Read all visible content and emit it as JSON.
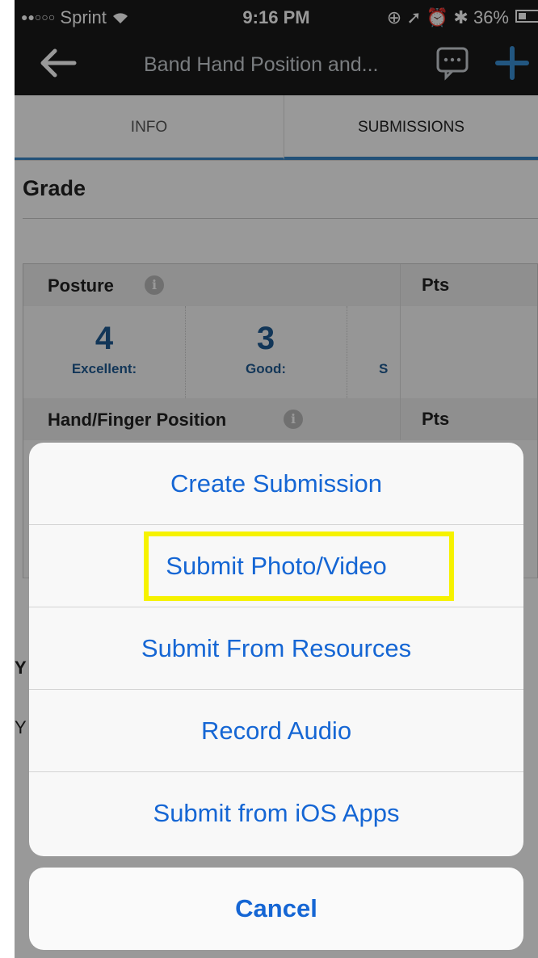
{
  "status_bar": {
    "carrier": "Sprint",
    "time": "9:16 PM",
    "battery": "36%"
  },
  "nav": {
    "title": "Band Hand Position and..."
  },
  "tabs": [
    {
      "label": "INFO"
    },
    {
      "label": "SUBMISSIONS"
    }
  ],
  "grade": {
    "heading": "Grade"
  },
  "rubric": {
    "criteria": [
      {
        "name": "Posture",
        "pts_label": "Pts",
        "levels": [
          {
            "score": "4",
            "label": "Excellent:"
          },
          {
            "score": "3",
            "label": "Good:"
          },
          {
            "score": "",
            "label": "S"
          }
        ]
      },
      {
        "name": "Hand/Finger Position",
        "pts_label": "Pts"
      }
    ]
  },
  "partial_text": {
    "line1": "Y",
    "line2": "Y"
  },
  "action_sheet": {
    "items": [
      {
        "label": "Create Submission"
      },
      {
        "label": "Submit Photo/Video"
      },
      {
        "label": "Submit From Resources"
      },
      {
        "label": "Record Audio"
      },
      {
        "label": "Submit from iOS Apps"
      }
    ],
    "cancel": "Cancel"
  },
  "colors": {
    "accent": "#1566d4",
    "highlight": "#f6f200",
    "tab_indicator": "#3a87c8"
  }
}
